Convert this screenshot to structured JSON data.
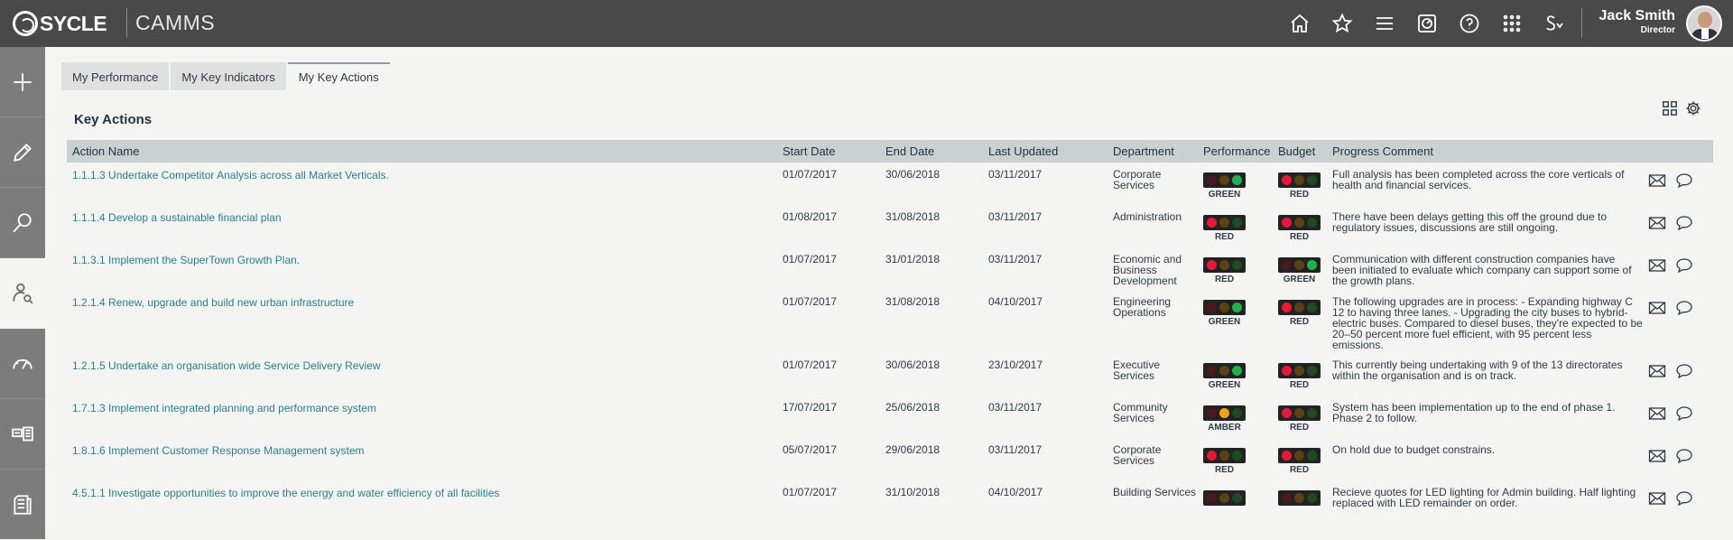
{
  "brand": {
    "logo_text": "SYCLE",
    "app_title": "CAMMS"
  },
  "topbar_icons": [
    "home-icon",
    "star-icon",
    "menu-icon",
    "dashboard-icon",
    "help-icon",
    "apps-grid-icon",
    "signature-icon"
  ],
  "user": {
    "name": "Jack Smith",
    "role": "Director"
  },
  "sidebar_icons": [
    "add-icon",
    "edit-icon",
    "search-icon",
    "performance-user-icon",
    "gauge-icon",
    "cards-icon",
    "reports-icon"
  ],
  "tabs": [
    "My Performance",
    "My Key Indicators",
    "My Key Actions"
  ],
  "active_tab": "My Key Actions",
  "section_title": "Key Actions",
  "columns": [
    "Action Name",
    "Start Date",
    "End Date",
    "Last Updated",
    "Department",
    "Performance",
    "Budget",
    "Progress Comment"
  ],
  "status_colors": {
    "GREEN": "#1db24b",
    "RED": "#e8183a",
    "AMBER": "#f7a21b",
    "off_red": "#4a1a1f",
    "off_amber": "#5a4214",
    "off_green": "#1e4a24"
  },
  "rows": [
    {
      "action": "1.1.1.3 Undertake Competitor Analysis across all Market Verticals.",
      "start": "01/07/2017",
      "end": "30/06/2018",
      "updated": "03/11/2017",
      "dept": [
        "Corporate",
        "Services"
      ],
      "performance": "GREEN",
      "budget": "RED",
      "comment": [
        "Full analysis has been completed across the core verticals of",
        "health and financial services."
      ]
    },
    {
      "action": "1.1.1.4 Develop a sustainable financial plan",
      "start": "01/08/2017",
      "end": "31/08/2018",
      "updated": "03/11/2017",
      "dept": [
        "Administration"
      ],
      "performance": "RED",
      "budget": "RED",
      "comment": [
        "There have been delays getting this off the ground due to",
        "regulatory issues, discussions are still ongoing."
      ]
    },
    {
      "action": "1.1.3.1 Implement the SuperTown Growth Plan.",
      "start": "01/07/2017",
      "end": "31/01/2018",
      "updated": "03/11/2017",
      "dept": [
        "Economic and",
        "Business",
        "Development"
      ],
      "performance": "RED",
      "budget": "GREEN",
      "comment": [
        "Communication with different construction companies have",
        "been initiated to evaluate which company can support some of",
        "the growth plans."
      ]
    },
    {
      "action": "1.2.1.4 Renew, upgrade and build new urban infrastructure",
      "start": "01/07/2017",
      "end": "31/08/2018",
      "updated": "04/10/2017",
      "dept": [
        "Engineering",
        "Operations"
      ],
      "performance": "GREEN",
      "budget": "RED",
      "comment": [
        "The following upgrades are in process: - Expanding highway C",
        "12 to having three lanes. - Upgrading the city buses to hybrid-",
        "electric buses. Compared to diesel buses, they're expected to be",
        "20–50 percent more fuel efficient, with 95 percent less",
        "emissions."
      ]
    },
    {
      "action": "1.2.1.5 Undertake an organisation wide Service Delivery Review",
      "start": "01/07/2017",
      "end": "30/06/2018",
      "updated": "23/10/2017",
      "dept": [
        "Executive",
        "Services"
      ],
      "performance": "GREEN",
      "budget": "RED",
      "comment": [
        "This currently being undertaking with 9 of the 13 directorates",
        "within the organisation and is on track."
      ]
    },
    {
      "action": "1.7.1.3 Implement integrated planning and performance system",
      "start": "17/07/2017",
      "end": "25/06/2018",
      "updated": "03/11/2017",
      "dept": [
        "Community",
        "Services"
      ],
      "performance": "AMBER",
      "budget": "RED",
      "comment": [
        "System has been implementation up to the end of phase 1.",
        "Phase 2 to follow."
      ]
    },
    {
      "action": "1.8.1.6 Implement Customer Response Management system",
      "start": "05/07/2017",
      "end": "29/06/2018",
      "updated": "03/11/2017",
      "dept": [
        "Corporate",
        "Services"
      ],
      "performance": "RED",
      "budget": "RED",
      "comment": [
        "On hold due to budget constrains."
      ]
    },
    {
      "action": "4.5.1.1 Investigate opportunities to improve the energy and water efficiency of all facilities",
      "start": "01/07/2017",
      "end": "31/10/2018",
      "updated": "04/10/2017",
      "dept": [
        "Building Services"
      ],
      "performance": "",
      "budget": "",
      "comment": [
        "Recieve quotes for LED lighting for Admin building. Half lighting",
        "replaced with LED remainder on order."
      ]
    }
  ]
}
